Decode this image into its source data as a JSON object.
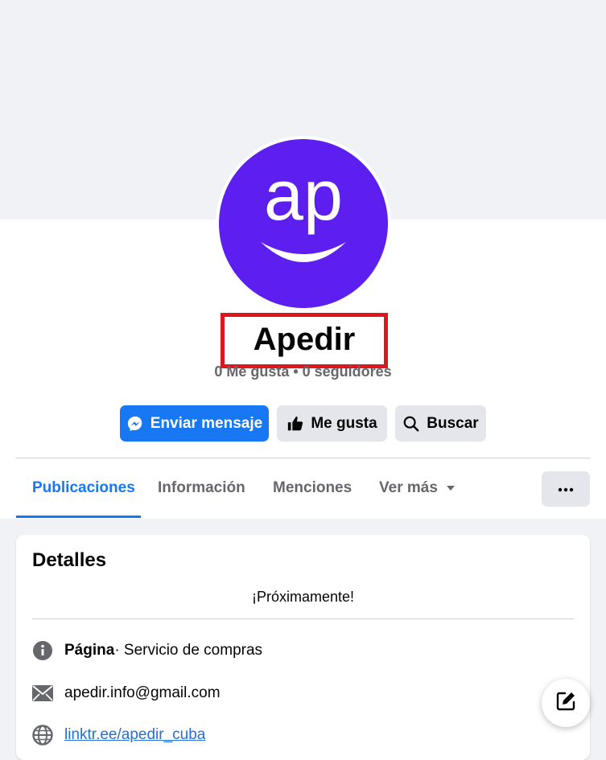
{
  "profile": {
    "name": "Apedir",
    "stats": "0 Me gusta • 0 seguidores",
    "avatar_text": "ap"
  },
  "actions": {
    "message_label": "Enviar mensaje",
    "like_label": "Me gusta",
    "search_label": "Buscar"
  },
  "tabs": [
    {
      "label": "Publicaciones",
      "active": true
    },
    {
      "label": "Información",
      "active": false
    },
    {
      "label": "Menciones",
      "active": false
    },
    {
      "label": "Ver más",
      "active": false
    }
  ],
  "details": {
    "title": "Detalles",
    "bio": "¡Próximamente!",
    "category_label": "Página",
    "category_value": " · Servicio de compras",
    "email": "apedir.info@gmail.com",
    "website": "linktr.ee/apedir_cuba"
  },
  "colors": {
    "accent": "#1877f2",
    "avatar_bg": "#5d1ff0",
    "highlight": "#e0161e"
  },
  "icons": [
    "messenger-icon",
    "thumbs-up-icon",
    "search-icon",
    "caret-down-icon",
    "more-dots-icon",
    "info-icon",
    "mail-icon",
    "globe-icon",
    "compose-icon"
  ]
}
